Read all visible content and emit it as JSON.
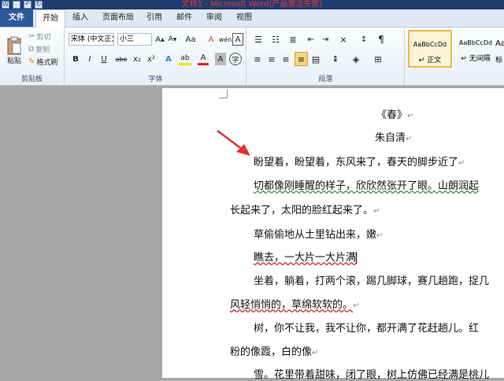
{
  "window": {
    "title": "文档1 - Microsoft Word(产品激活失败)"
  },
  "tabs": {
    "file": "文件",
    "home": "开始",
    "insert": "插入",
    "layout": "页面布局",
    "references": "引用",
    "mailings": "邮件",
    "review": "审阅",
    "view": "视图"
  },
  "clipboard": {
    "paste": "粘贴",
    "cut": "剪切",
    "copy": "复制",
    "format_painter": "格式刷",
    "label": "剪贴板"
  },
  "font": {
    "family": "宋体 (中文正文)",
    "size": "小三",
    "grow": "A",
    "shrink": "A",
    "change_case": "Aa",
    "clear_format": "A",
    "phonetic": "wén",
    "border_char": "A",
    "bold": "B",
    "italic": "I",
    "underline": "U",
    "strike": "abe",
    "subscript": "x₂",
    "superscript": "x²",
    "text_effect": "A",
    "highlight": "ab",
    "font_color": "A",
    "char_shading": "A",
    "enclose": "字",
    "label": "字体"
  },
  "paragraph": {
    "label": "段落"
  },
  "styles": [
    {
      "sample": "AaBbCcDd",
      "name": "↵ 正文"
    },
    {
      "sample": "AaBbCcDd",
      "name": "↵ 无间隔"
    },
    {
      "sample": "AaBl",
      "name": "标"
    }
  ],
  "document": {
    "lines": [
      {
        "text": "《春》",
        "mark": "↵"
      },
      {
        "text": "朱自清",
        "mark": "↵"
      },
      {
        "text": "盼望着，盼望着，东风来了，春天的脚步近了",
        "mark": "↵"
      },
      {
        "text": "切都像刚睡醒的样子，欣欣然张开了眼。山朗润起",
        "mark": ""
      },
      {
        "text": "长起来了，太阳的脸红起来了。",
        "mark": "↵"
      },
      {
        "text": "草偷偷地从土里钻出来，嫩",
        "mark": "↵"
      },
      {
        "text": "瞧去，一大片一大片满",
        "mark": ""
      },
      {
        "text": "坐着，躺着，打两个滚，踢几脚球，赛几趟跑，捉几",
        "mark": ""
      },
      {
        "text": "风轻悄悄的，草绵软软的。",
        "mark": "↵"
      },
      {
        "text": "树，你不让我，我不让你，都开满了花赶趟儿。红",
        "mark": ""
      },
      {
        "text": "粉的像霞，白的像",
        "mark": "↵"
      },
      {
        "text": "雪。花里带着甜味，闭了眼，树上仿佛已经满是桃儿",
        "mark": ""
      }
    ]
  },
  "colors": {
    "title_text": "#f03737",
    "arrow": "#e53030",
    "file_tab": "#2a5a9c"
  }
}
